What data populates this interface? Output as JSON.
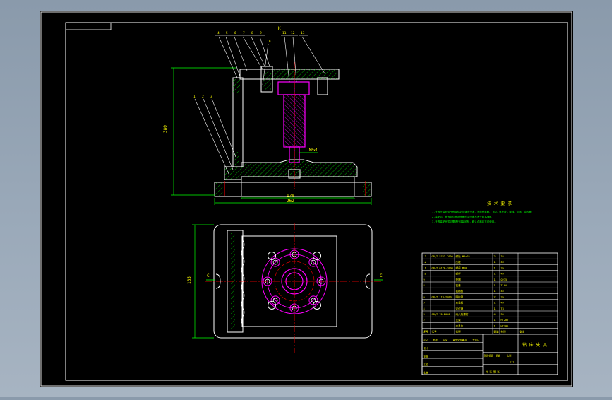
{
  "sheet": {
    "background": "#000000",
    "frame_color": "#ffffff"
  },
  "colors": {
    "part_outline": "#ffffff",
    "hatch": "#00d000",
    "highlight": "#ff00ff",
    "centerline": "#ff0000",
    "dimension": "#00ff00",
    "leader": "#ffffff",
    "text_yellow": "#ffff00",
    "note_green": "#00ff00"
  },
  "drawing": {
    "front_view": {
      "balloons": [
        "4",
        "5",
        "6",
        "7",
        "8",
        "9",
        "10",
        "11",
        "12",
        "13",
        "1",
        "2",
        "3"
      ],
      "dims": {
        "height": "380",
        "base_inner": "170",
        "base_outer": "262",
        "thread": "M8×1"
      },
      "section_mark": "K"
    },
    "top_view": {
      "dims": {
        "height": "165"
      },
      "view_marks": [
        "C",
        "C"
      ]
    }
  },
  "tech_requirements": {
    "title": "技 术 要 求",
    "lines": [
      "1.夹具在装配前所有零件必须清洗干净，不得有毛刺、飞边、氧化皮、锈蚀、切屑、油污等。",
      "2.装配后，夹具定位面对底面的平行度不大于0.02mm。",
      "3.夹具装配完成后需进行试装检验，确认合格后方可使用。"
    ]
  },
  "bom": {
    "rows": [
      [
        "13",
        "GB/T 5783-2000",
        "螺栓 M8×25",
        "2",
        "35",
        ""
      ],
      [
        "12",
        "",
        "压板",
        "1",
        "45",
        ""
      ],
      [
        "11",
        "GB/T 6170-2000",
        "螺母 M10",
        "1",
        "35",
        ""
      ],
      [
        "10",
        "",
        "螺杆",
        "1",
        "45",
        ""
      ],
      [
        "9",
        "",
        "垫圈",
        "1",
        "Q235",
        ""
      ],
      [
        "8",
        "",
        "钻套",
        "1",
        "T10A",
        ""
      ],
      [
        "7",
        "",
        "钻模板",
        "1",
        "45",
        ""
      ],
      [
        "6",
        "GB/T 119-2000",
        "圆柱销",
        "2",
        "35",
        ""
      ],
      [
        "5",
        "",
        "支承板",
        "1",
        "45",
        ""
      ],
      [
        "4",
        "",
        "定位销",
        "1",
        "T8",
        ""
      ],
      [
        "3",
        "GB/T 70-2000",
        "内六角螺钉",
        "4",
        "35",
        ""
      ],
      [
        "2",
        "",
        "支架",
        "1",
        "HT200",
        ""
      ],
      [
        "1",
        "",
        "夹具体",
        "1",
        "HT200",
        ""
      ]
    ],
    "header": [
      "序号",
      "代号",
      "名称",
      "数量",
      "材料",
      "备注"
    ],
    "title_block": {
      "drawing_name": "钻 床 夹 具",
      "labels": [
        "标记",
        "处数",
        "分区",
        "更改文件号",
        "签名",
        "年月日"
      ],
      "roles": [
        "设计",
        "审核",
        "工艺",
        "批准"
      ],
      "stage_labels": [
        "阶段标记",
        "重量",
        "比例"
      ],
      "scale": "1:1",
      "sheet": "共 张 第 张"
    }
  }
}
